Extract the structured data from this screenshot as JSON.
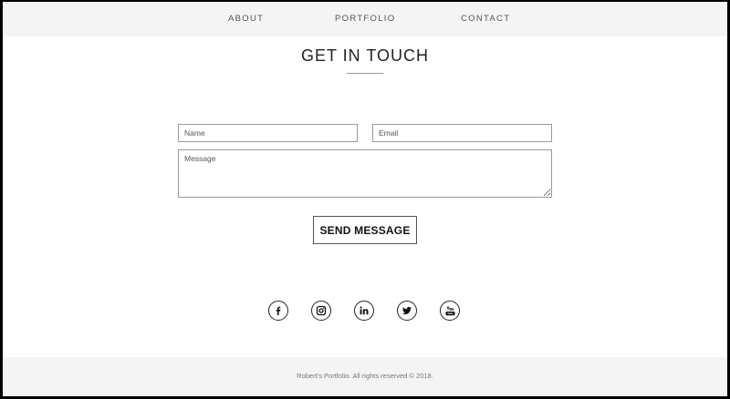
{
  "nav": {
    "items": [
      {
        "label": "ABOUT"
      },
      {
        "label": "PORTFOLIO"
      },
      {
        "label": "CONTACT"
      }
    ]
  },
  "contact": {
    "title": "GET IN TOUCH",
    "name_placeholder": "Name",
    "email_placeholder": "Email",
    "message_placeholder": "Message",
    "send_label": "SEND MESSAGE"
  },
  "social": {
    "icons": [
      "facebook-icon",
      "instagram-icon",
      "linkedin-icon",
      "twitter-icon",
      "youtube-icon"
    ]
  },
  "footer": {
    "text": "Robert’s Portfolio. All rights reserved © 2018."
  }
}
